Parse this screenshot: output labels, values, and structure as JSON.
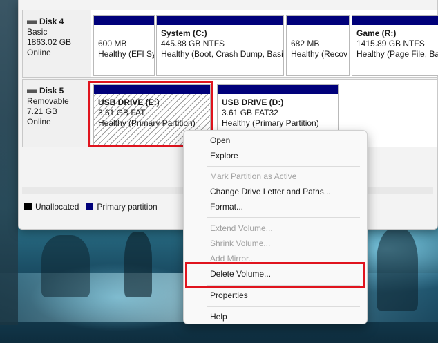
{
  "disks": [
    {
      "name": "Disk 4",
      "type": "Basic",
      "size": "1863.02 GB",
      "status": "Online",
      "partitions": [
        {
          "title": "",
          "size": "600 MB",
          "status": "Healthy (EFI Sy"
        },
        {
          "title": "System  (C:)",
          "size": "445.88 GB NTFS",
          "status": "Healthy (Boot, Crash Dump, Basi"
        },
        {
          "title": "",
          "size": "682 MB",
          "status": "Healthy (Recov"
        },
        {
          "title": "Game  (R:)",
          "size": "1415.89 GB NTFS",
          "status": "Healthy (Page File, Bas"
        }
      ]
    },
    {
      "name": "Disk 5",
      "type": "Removable",
      "size": "7.21 GB",
      "status": "Online",
      "partitions": [
        {
          "title": "USB DRIVE  (E:)",
          "size": "3.61 GB FAT",
          "status": "Healthy (Primary Partition)"
        },
        {
          "title": "USB DRIVE  (D:)",
          "size": "3.61 GB FAT32",
          "status": "Healthy (Primary Partition)"
        }
      ]
    }
  ],
  "legend": [
    {
      "label": "Unallocated",
      "color": "#000000"
    },
    {
      "label": "Primary partition",
      "color": "#00007a"
    }
  ],
  "context_menu": {
    "items": [
      {
        "label": "Open",
        "enabled": true
      },
      {
        "label": "Explore",
        "enabled": true
      },
      {
        "label": "Mark Partition as Active",
        "enabled": false
      },
      {
        "label": "Change Drive Letter and Paths...",
        "enabled": true
      },
      {
        "label": "Format...",
        "enabled": true
      },
      {
        "label": "Extend Volume...",
        "enabled": false
      },
      {
        "label": "Shrink Volume...",
        "enabled": false
      },
      {
        "label": "Add Mirror...",
        "enabled": false
      },
      {
        "label": "Delete Volume...",
        "enabled": true
      },
      {
        "label": "Properties",
        "enabled": true
      },
      {
        "label": "Help",
        "enabled": true
      }
    ]
  },
  "colors": {
    "primary_partition": "#00007a",
    "highlight": "#e0141e"
  }
}
